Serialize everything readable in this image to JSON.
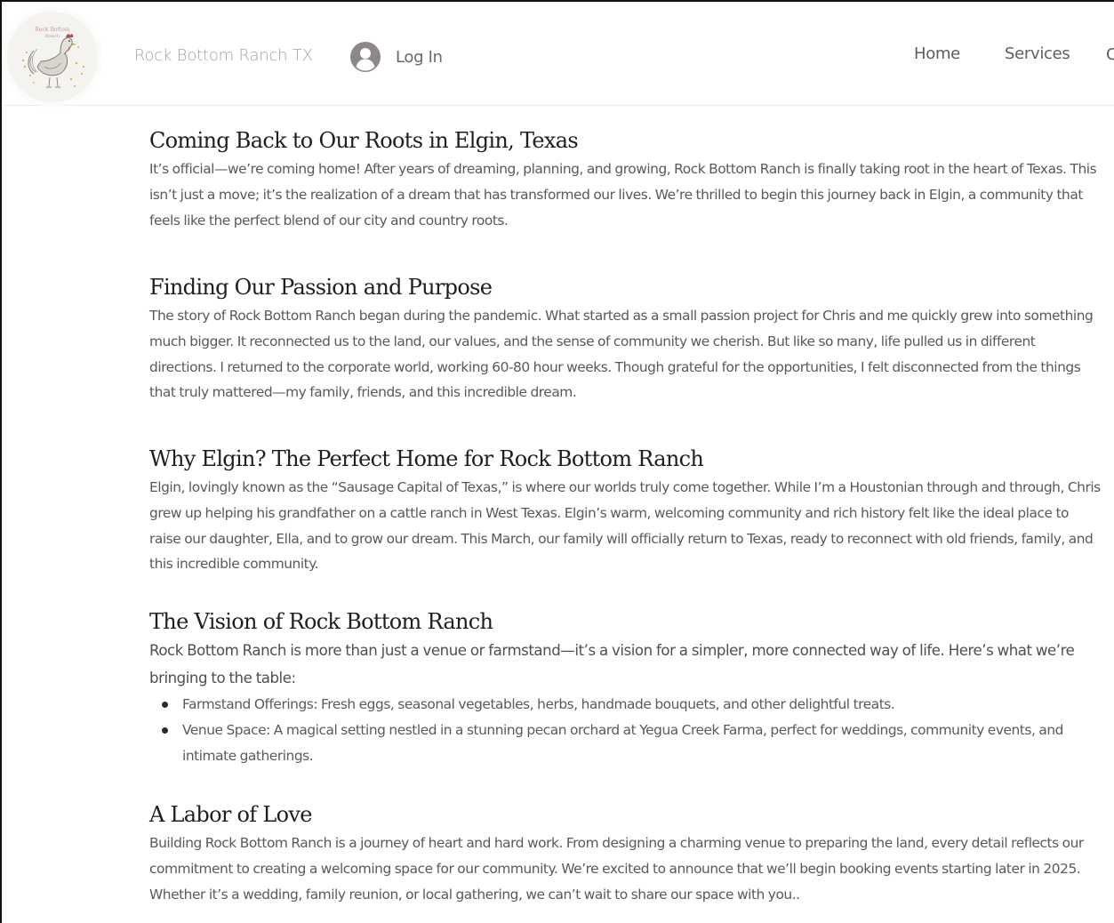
{
  "header": {
    "logo_text": "Rock Bottom Ranch",
    "site_title": "Rock Bottom Ranch TX",
    "login_label": "Log In",
    "nav": [
      {
        "label": "Home"
      },
      {
        "label": "Services"
      }
    ],
    "nav_cut_glyph": "C"
  },
  "sections": [
    {
      "heading": "Coming Back to Our Roots in Elgin, Texas",
      "body": "It’s official—we’re coming home! After years of dreaming, planning, and growing, Rock Bottom Ranch is finally taking root in the heart of Texas. This isn’t just a move; it’s the realization of a dream that has transformed our lives. We’re thrilled to begin this journey back in Elgin, a community that feels like the perfect blend of our city and country roots."
    },
    {
      "heading": "Finding Our Passion and Purpose",
      "body": "The story of Rock Bottom Ranch began during the pandemic. What started as a small passion project for Chris and me quickly grew into something much bigger. It reconnected us to the land, our values, and the sense of community we cherish. But like so many, life pulled us in different directions. I returned to the corporate world, working 60-80 hour weeks. Though grateful for the opportunities, I felt disconnected from the things that truly mattered—my family, friends, and this incredible dream."
    },
    {
      "heading": "Why Elgin? The Perfect Home for Rock Bottom Ranch",
      "body": "Elgin, lovingly known as the “Sausage Capital of Texas,” is where our worlds truly come together. While I’m a Houstonian through and through, Chris grew up helping his grandfather on a cattle ranch in West Texas. Elgin’s warm, welcoming community and rich history felt like the ideal place to raise our daughter, Ella, and to grow our dream. This March, our family will officially return to Texas, ready to reconnect with old friends, family, and this incredible community."
    },
    {
      "heading": "The Vision of Rock Bottom Ranch",
      "body": "Rock Bottom Ranch is more than just a venue or farmstand—it’s a vision for a simpler, more connected way of life. Here’s what we’re bringing to the table:",
      "items": [
        "Farmstand Offerings: Fresh eggs, seasonal vegetables, herbs, handmade bouquets, and other delightful treats.",
        "Venue Space: A magical setting nestled in a stunning pecan orchard at Yegua Creek Farma, perfect for weddings, community events, and intimate gatherings."
      ]
    },
    {
      "heading": "A Labor of Love",
      "body": "Building Rock Bottom Ranch is a journey of heart and hard work. From designing a charming venue to preparing the land, every detail reflects our commitment to creating a welcoming space for our community. We’re excited to announce that we’ll begin booking events starting later in 2025. Whether it’s a wedding, family reunion, or local gathering, we can’t wait to share our space with you.."
    }
  ]
}
